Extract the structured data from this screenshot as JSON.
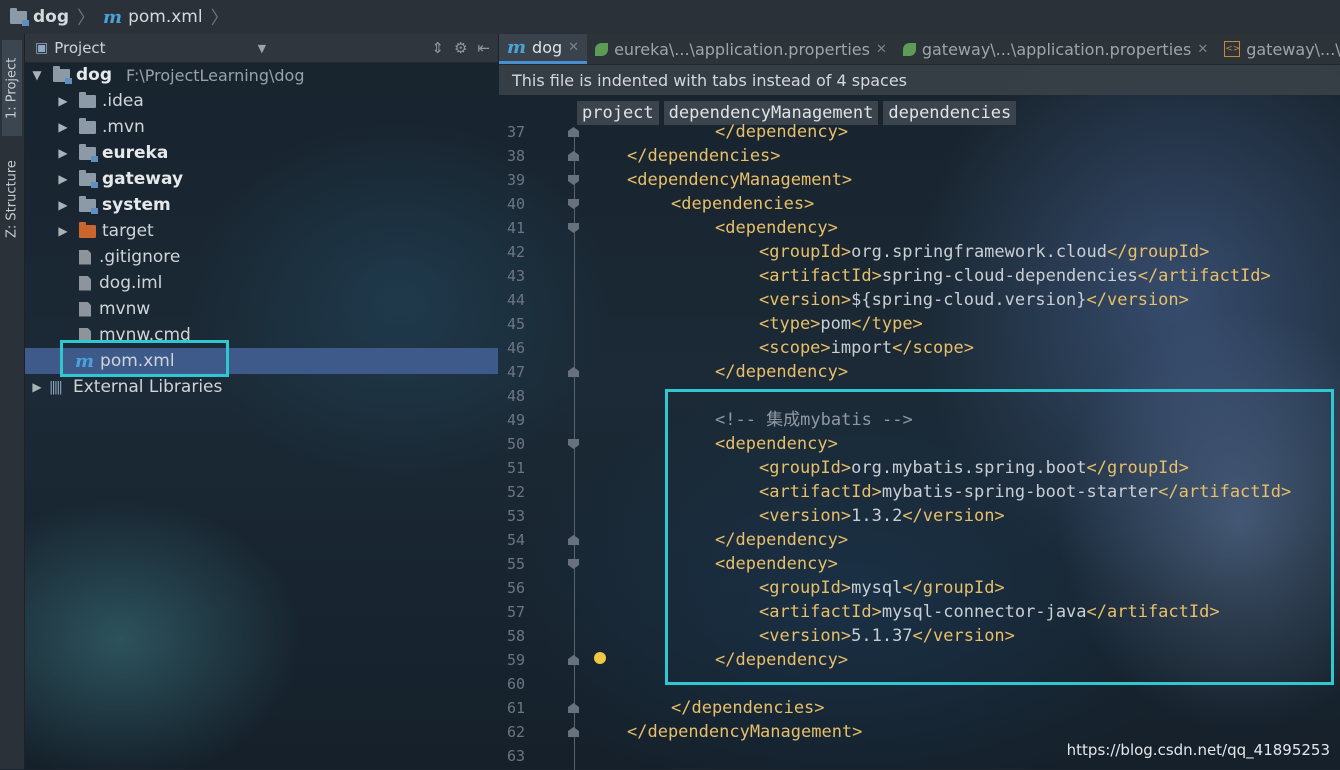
{
  "breadcrumb": {
    "project": "dog",
    "file": "pom.xml"
  },
  "toolwindows": {
    "project_tab": "1: Project",
    "structure_tab": "Z: Structure"
  },
  "panel": {
    "title": "Project"
  },
  "tree": [
    {
      "label": "dog",
      "hint": "F:\\ProjectLearning\\dog",
      "level": 0,
      "expanded": true,
      "bold": true,
      "icon": "project-folder-icon"
    },
    {
      "label": ".idea",
      "level": 1,
      "expanded": false,
      "bold": false,
      "icon": "folder-icon"
    },
    {
      "label": ".mvn",
      "level": 1,
      "expanded": false,
      "bold": false,
      "icon": "folder-icon"
    },
    {
      "label": "eureka",
      "level": 1,
      "expanded": false,
      "bold": true,
      "icon": "module-folder-icon"
    },
    {
      "label": "gateway",
      "level": 1,
      "expanded": false,
      "bold": true,
      "icon": "module-folder-icon"
    },
    {
      "label": "system",
      "level": 1,
      "expanded": false,
      "bold": true,
      "icon": "module-folder-icon"
    },
    {
      "label": "target",
      "level": 1,
      "expanded": false,
      "bold": false,
      "icon": "excluded-folder-icon"
    },
    {
      "label": ".gitignore",
      "level": 1,
      "bold": false,
      "icon": "file-icon"
    },
    {
      "label": "dog.iml",
      "level": 1,
      "bold": false,
      "icon": "file-icon"
    },
    {
      "label": "mvnw",
      "level": 1,
      "bold": false,
      "icon": "file-icon"
    },
    {
      "label": "mvnw.cmd",
      "level": 1,
      "bold": false,
      "icon": "file-icon"
    },
    {
      "label": "pom.xml",
      "level": 1,
      "bold": false,
      "icon": "maven-icon",
      "selected": true
    },
    {
      "label": "External Libraries",
      "level": 0,
      "expanded": false,
      "bold": false,
      "icon": "library-icon"
    }
  ],
  "tabs": [
    {
      "label": "dog",
      "icon": "maven-icon",
      "active": true
    },
    {
      "label": "eureka\\...\\application.properties",
      "icon": "spring-leaf-icon",
      "active": false
    },
    {
      "label": "gateway\\...\\application.properties",
      "icon": "spring-leaf-icon",
      "active": false
    },
    {
      "label": "gateway\\...\\lo",
      "icon": "xml-file-icon",
      "active": false
    }
  ],
  "notice": "This file is indented with tabs instead of 4 spaces",
  "xml_path": [
    "project",
    "dependencyManagement",
    "dependencies"
  ],
  "code_lines": [
    {
      "n": "37",
      "indent": 3,
      "text": "</dependency>",
      "fold": "close"
    },
    {
      "n": "38",
      "indent": 1,
      "text": "</dependencies>",
      "fold": "close"
    },
    {
      "n": "39",
      "indent": 1,
      "text": "<dependencyManagement>",
      "fold": "open"
    },
    {
      "n": "40",
      "indent": 2,
      "text": "<dependencies>",
      "fold": "open"
    },
    {
      "n": "41",
      "indent": 3,
      "text": "<dependency>",
      "fold": "open"
    },
    {
      "n": "42",
      "indent": 4,
      "text": "<groupId>org.springframework.cloud</groupId>"
    },
    {
      "n": "43",
      "indent": 4,
      "text": "<artifactId>spring-cloud-dependencies</artifactId>"
    },
    {
      "n": "44",
      "indent": 4,
      "text": "<version>${spring-cloud.version}</version>"
    },
    {
      "n": "45",
      "indent": 4,
      "text": "<type>pom</type>"
    },
    {
      "n": "46",
      "indent": 4,
      "text": "<scope>import</scope>"
    },
    {
      "n": "47",
      "indent": 3,
      "text": "</dependency>",
      "fold": "close"
    },
    {
      "n": "48",
      "indent": 0,
      "text": ""
    },
    {
      "n": "49",
      "indent": 3,
      "text": "<!-- 集成mybatis -->",
      "comment": true
    },
    {
      "n": "50",
      "indent": 3,
      "text": "<dependency>",
      "fold": "open"
    },
    {
      "n": "51",
      "indent": 4,
      "text": "<groupId>org.mybatis.spring.boot</groupId>"
    },
    {
      "n": "52",
      "indent": 4,
      "text": "<artifactId>mybatis-spring-boot-starter</artifactId>"
    },
    {
      "n": "53",
      "indent": 4,
      "text": "<version>1.3.2</version>"
    },
    {
      "n": "54",
      "indent": 3,
      "text": "</dependency>",
      "fold": "close"
    },
    {
      "n": "55",
      "indent": 3,
      "text": "<dependency>",
      "fold": "open"
    },
    {
      "n": "56",
      "indent": 4,
      "text": "<groupId>mysql</groupId>"
    },
    {
      "n": "57",
      "indent": 4,
      "text": "<artifactId>mysql-connector-java</artifactId>"
    },
    {
      "n": "58",
      "indent": 4,
      "text": "<version>5.1.37</version>"
    },
    {
      "n": "59",
      "indent": 3,
      "text": "</dependency>",
      "fold": "close",
      "bulb": true
    },
    {
      "n": "60",
      "indent": 0,
      "text": ""
    },
    {
      "n": "61",
      "indent": 2,
      "text": "</dependencies>",
      "fold": "close"
    },
    {
      "n": "62",
      "indent": 1,
      "text": "</dependencyManagement>",
      "fold": "close"
    },
    {
      "n": "63",
      "indent": 0,
      "text": ""
    }
  ],
  "watermark": "https://blog.csdn.net/qq_41895253",
  "colors": {
    "highlight_box": "#2fc7d0",
    "selection": "#3d5a8a",
    "xml_tag": "#e8bf6a"
  }
}
